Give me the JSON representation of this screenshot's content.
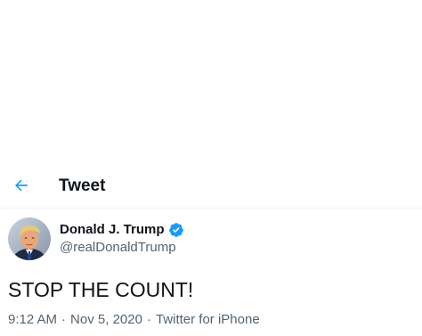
{
  "colors": {
    "accent": "#1d9bf0",
    "text_primary": "#0f1419",
    "text_secondary": "#536471",
    "divider": "#eff3f4"
  },
  "header": {
    "back_icon": "arrow-left-icon",
    "title": "Tweet"
  },
  "author": {
    "avatar_icon": "avatar",
    "name": "Donald J. Trump",
    "verified_icon": "verified-badge-icon",
    "handle": "@realDonaldTrump"
  },
  "tweet": {
    "text": "STOP THE COUNT!"
  },
  "meta": {
    "time": "9:12 AM",
    "separator": "·",
    "date": "Nov 5, 2020",
    "source": "Twitter for iPhone"
  }
}
